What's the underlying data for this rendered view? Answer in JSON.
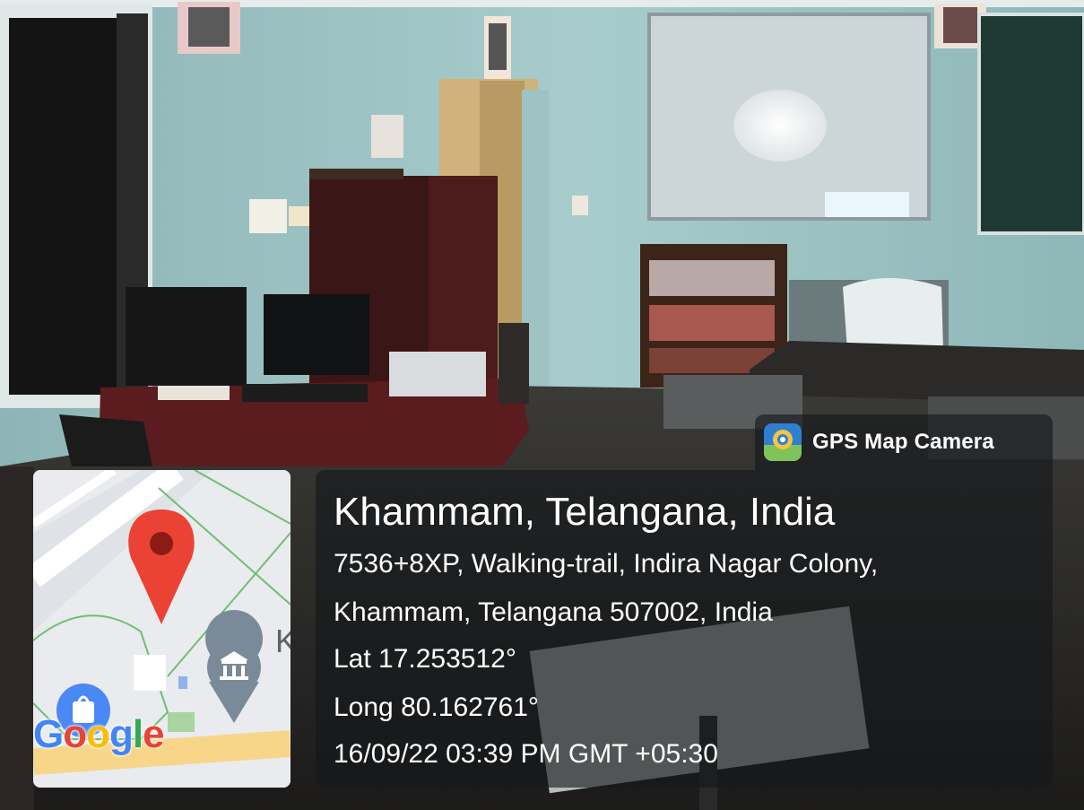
{
  "overlay": {
    "app_name": "GPS Map Camera",
    "app_icon": "gps-map-camera-icon",
    "location_title": "Khammam, Telangana, India",
    "address_line_1": "7536+8XP, Walking-trail, Indira Nagar Colony,",
    "address_line_2": "Khammam, Telangana 507002, India",
    "latitude": "Lat 17.253512°",
    "longitude": "Long 80.162761°",
    "timestamp": "16/09/22 03:39 PM GMT +05:30"
  },
  "map": {
    "place_label_fragment": "K",
    "logo": [
      "G",
      "o",
      "o",
      "g",
      "l",
      "e"
    ],
    "pin_color": "#EA4335",
    "marker_icons": [
      "location-pin-icon",
      "museum-icon",
      "shopping-bag-icon"
    ]
  },
  "photo": {
    "subject": "classroom-interior"
  }
}
